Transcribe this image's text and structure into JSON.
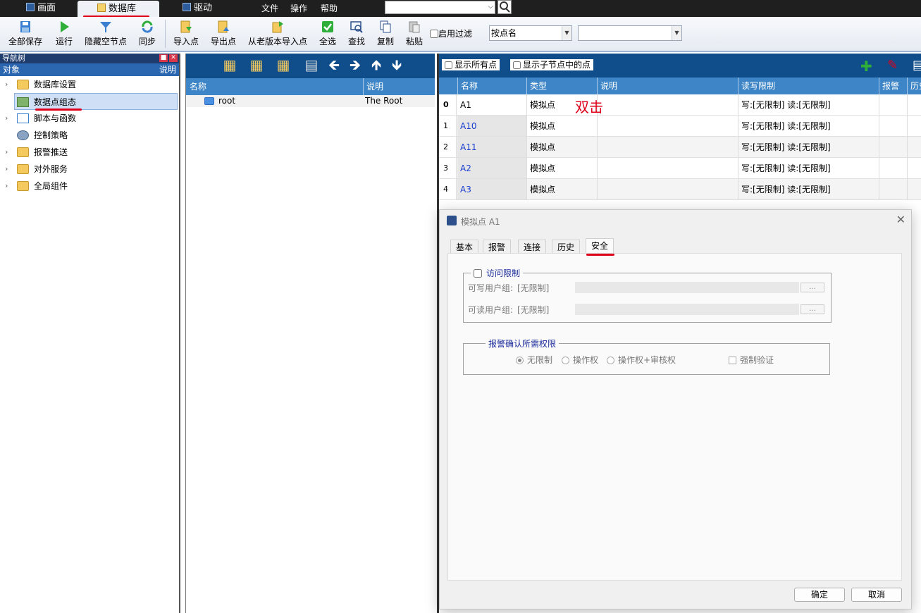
{
  "topbar": {
    "tabs": [
      {
        "label": "画面",
        "icon": "screen-icon"
      },
      {
        "label": "数据库",
        "icon": "database-icon"
      },
      {
        "label": "驱动",
        "icon": "driver-icon"
      }
    ],
    "menus": [
      "文件",
      "操作",
      "帮助"
    ],
    "search_value": ""
  },
  "toolbar": {
    "buttons": [
      {
        "label": "全部保存",
        "icon": "save-all-icon"
      },
      {
        "label": "运行",
        "icon": "run-icon"
      },
      {
        "label": "隐藏空节点",
        "icon": "filter-icon"
      },
      {
        "label": "同步",
        "icon": "sync-icon"
      },
      {
        "label": "导入点",
        "icon": "import-icon"
      },
      {
        "label": "导出点",
        "icon": "export-icon"
      },
      {
        "label": "从老版本导入点",
        "icon": "legacy-import-icon"
      },
      {
        "label": "全选",
        "icon": "select-all-icon"
      },
      {
        "label": "查找",
        "icon": "find-icon"
      },
      {
        "label": "复制",
        "icon": "copy-icon"
      },
      {
        "label": "粘贴",
        "icon": "paste-icon"
      }
    ],
    "filter_label": "启用过滤",
    "filter_mode": "按点名",
    "filter_value": ""
  },
  "nav": {
    "title": "导航树",
    "col_object": "对象",
    "col_desc": "说明",
    "items": [
      {
        "label": "数据库设置",
        "icon": "folder-icon"
      },
      {
        "label": "数据点组态",
        "icon": "point-config-icon"
      },
      {
        "label": "脚本与函数",
        "icon": "script-icon"
      },
      {
        "label": "控制策略",
        "icon": "gear-icon"
      },
      {
        "label": "报警推送",
        "icon": "folder-icon"
      },
      {
        "label": "对外服务",
        "icon": "folder-icon"
      },
      {
        "label": "全局组件",
        "icon": "globe-icon"
      }
    ]
  },
  "mid": {
    "col_name": "名称",
    "col_desc": "说明",
    "rows": [
      {
        "name": "root",
        "desc": "The Root"
      }
    ]
  },
  "right": {
    "show_all": "显示所有点",
    "show_children": "显示子节点中的点",
    "columns": [
      "名称",
      "类型",
      "说明",
      "读写限制",
      "报警",
      "历史"
    ],
    "rows": [
      {
        "index": "0",
        "name": "A1",
        "type": "模拟点",
        "access": "写:[无限制] 读:[无限制]"
      },
      {
        "index": "1",
        "name": "A10",
        "type": "模拟点",
        "access": "写:[无限制] 读:[无限制]"
      },
      {
        "index": "2",
        "name": "A11",
        "type": "模拟点",
        "access": "写:[无限制] 读:[无限制]"
      },
      {
        "index": "3",
        "name": "A2",
        "type": "模拟点",
        "access": "写:[无限制] 读:[无限制]"
      },
      {
        "index": "4",
        "name": "A3",
        "type": "模拟点",
        "access": "写:[无限制] 读:[无限制]"
      }
    ],
    "annotation": "双击"
  },
  "dialog": {
    "title": "模拟点 A1",
    "tabs": [
      "基本",
      "报警",
      "连接",
      "历史",
      "安全"
    ],
    "access_group": "访问限制",
    "write_label": "可写用户组:",
    "write_value": "[无限制]",
    "read_label": "可读用户组:",
    "read_value": "[无限制]",
    "browse": "...",
    "ack_group": "报警确认所需权限",
    "radios": [
      "无限制",
      "操作权",
      "操作权+审核权"
    ],
    "force_verify": "强制验证",
    "ok": "确定",
    "cancel": "取消"
  }
}
